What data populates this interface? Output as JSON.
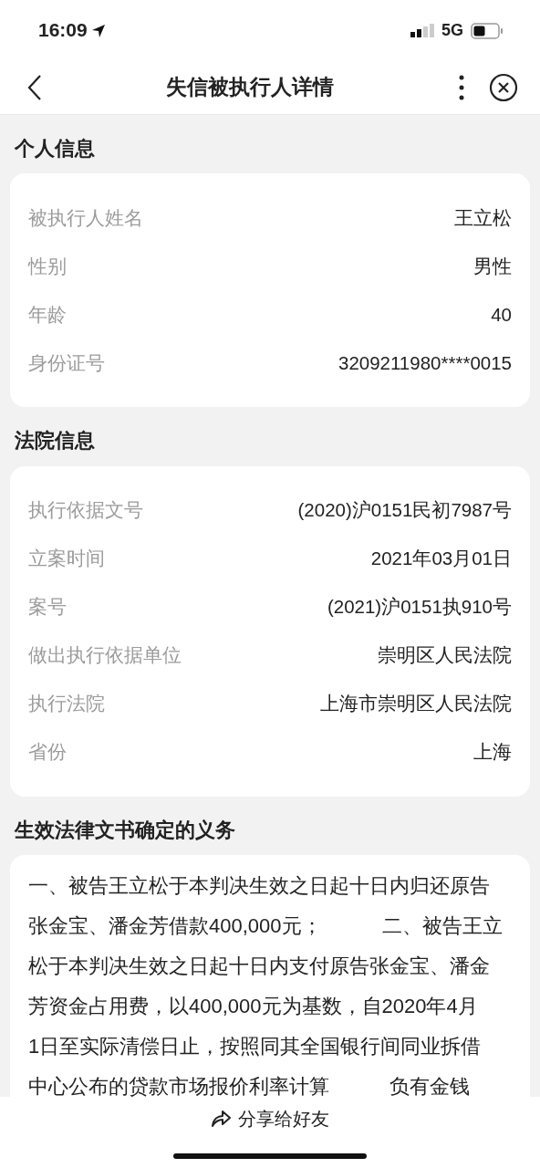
{
  "status_bar": {
    "time": "16:09",
    "network": "5G"
  },
  "nav": {
    "title": "失信被执行人详情"
  },
  "sections": [
    {
      "title": "个人信息",
      "kind": "fields",
      "rows": [
        {
          "label": "被执行人姓名",
          "value": "王立松"
        },
        {
          "label": "性别",
          "value": "男性"
        },
        {
          "label": "年龄",
          "value": "40"
        },
        {
          "label": "身份证号",
          "value": "3209211980****0015"
        }
      ]
    },
    {
      "title": "法院信息",
      "kind": "fields",
      "rows": [
        {
          "label": "执行依据文号",
          "value": "(2020)沪0151民初7987号"
        },
        {
          "label": "立案时间",
          "value": "2021年03月01日"
        },
        {
          "label": "案号",
          "value": "(2021)沪0151执910号"
        },
        {
          "label": "做出执行依据单位",
          "value": "崇明区人民法院"
        },
        {
          "label": "执行法院",
          "value": "上海市崇明区人民法院"
        },
        {
          "label": "省份",
          "value": "上海"
        }
      ]
    },
    {
      "title": "生效法律文书确定的义务",
      "kind": "text",
      "lines": [
        "一、被告王立松于本判决生效之日起十日内归还原告",
        "张金宝、潘金芳借款400,000元；　　　二、被告王立",
        "松于本判决生效之日起十日内支付原告张金宝、潘金",
        "芳资金占用费，以400,000元为基数，自2020年4月",
        "1日至实际清偿日止，按照同其全国银行间同业拆借",
        "中心公布的贷款市场报价利率计算　　　负有金钱"
      ]
    }
  ],
  "bottom_bar": {
    "action": "分享给好友"
  }
}
